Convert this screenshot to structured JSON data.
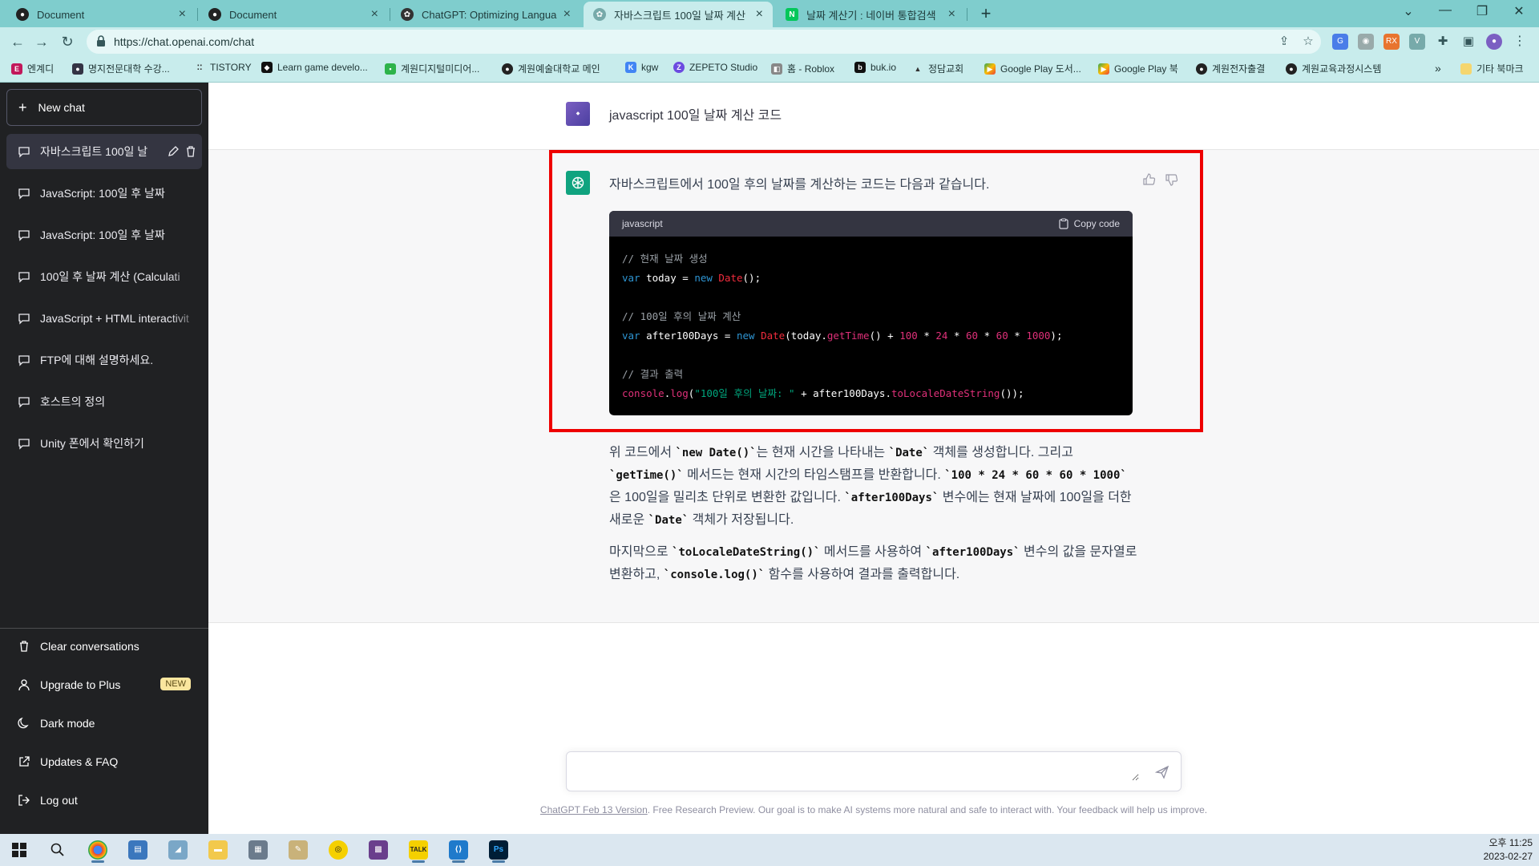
{
  "tabs": [
    {
      "title": "Document",
      "active": false,
      "favicon": "github-icon"
    },
    {
      "title": "Document",
      "active": false,
      "favicon": "github-icon"
    },
    {
      "title": "ChatGPT: Optimizing Language",
      "active": false,
      "favicon": "openai-icon"
    },
    {
      "title": "자바스크립트 100일 날짜 계산",
      "active": true,
      "favicon": "openai-icon"
    },
    {
      "title": "날짜 계산기 : 네이버 통합검색",
      "active": false,
      "favicon": "naver-icon"
    }
  ],
  "address_bar": {
    "url": "https://chat.openai.com/chat"
  },
  "bookmarks": [
    {
      "label": "엔계디",
      "icon": "bookmark-icon"
    },
    {
      "label": "명지전문대학 수강...",
      "icon": "bookmark-icon"
    },
    {
      "label": "TISTORY",
      "icon": "bookmark-icon"
    },
    {
      "label": "Learn game develo...",
      "icon": "bookmark-icon"
    },
    {
      "label": "계원디지털미디어...",
      "icon": "bookmark-icon"
    },
    {
      "label": "계원예술대학교 메인",
      "icon": "bookmark-icon"
    },
    {
      "label": "kgw",
      "icon": "bookmark-icon"
    },
    {
      "label": "ZEPETO Studio",
      "icon": "bookmark-icon"
    },
    {
      "label": "홈 - Roblox",
      "icon": "bookmark-icon"
    },
    {
      "label": "buk.io",
      "icon": "bookmark-icon"
    },
    {
      "label": "정담교회",
      "icon": "bookmark-icon"
    },
    {
      "label": "Google Play 도서...",
      "icon": "google-play-icon"
    },
    {
      "label": "Google Play 북",
      "icon": "google-play-icon"
    },
    {
      "label": "계원전자출결",
      "icon": "bookmark-icon"
    },
    {
      "label": "계원교육과정시스템",
      "icon": "bookmark-icon"
    }
  ],
  "bookmarks_overflow": "»",
  "bookmarks_other": "기타 북마크",
  "sidebar": {
    "new_chat": "New chat",
    "conversations": [
      {
        "label": "자바스크립트 100일 날",
        "active": true
      },
      {
        "label": "JavaScript: 100일 후 날짜",
        "active": false
      },
      {
        "label": "JavaScript: 100일 후 날짜",
        "active": false
      },
      {
        "label": "100일 후 날짜 계산 (Calculati",
        "active": false
      },
      {
        "label": "JavaScript + HTML interactivit",
        "active": false
      },
      {
        "label": "FTP에 대해 설명하세요.",
        "active": false
      },
      {
        "label": "호스트의 정의",
        "active": false
      },
      {
        "label": "Unity 폰에서 확인하기",
        "active": false
      }
    ],
    "bottom": {
      "clear": "Clear conversations",
      "upgrade": "Upgrade to Plus",
      "upgrade_badge": "NEW",
      "dark_mode": "Dark mode",
      "updates": "Updates & FAQ",
      "logout": "Log out"
    }
  },
  "chat": {
    "user_message": "javascript 100일 날짜 계산 코드",
    "assistant_intro": "자바스크립트에서 100일 후의 날짜를 계산하는 코드는 다음과 같습니다.",
    "code_block": {
      "language": "javascript",
      "copy_label": "Copy code",
      "lines": [
        "// 현재 날짜 생성",
        "var today = new Date();",
        "",
        "// 100일 후의 날짜 계산",
        "var after100Days = new Date(today.getTime() + 100 * 24 * 60 * 60 * 1000);",
        "",
        "// 결과 출력",
        "console.log(\"100일 후의 날짜: \" + after100Days.toLocaleDateString());"
      ]
    },
    "paragraph1": {
      "t1": "위 코드에서 ",
      "c1": "`new Date()`",
      "t2": "는 현재 시간을 나타내는 ",
      "c2": "`Date`",
      "t3": " 객체를 생성합니다. 그리고 ",
      "c3": "`getTime()`",
      "t4": " 메서드는 현재 시간의 타임스탬프를 반환합니다. ",
      "c4": "`100 * 24 * 60 * 60 * 1000`",
      "t5": "은 100일을 밀리초 단위로 변환한 값입니다. ",
      "c5": "`after100Days`",
      "t6": " 변수에는 현재 날짜에 100일을 더한 새로운 ",
      "c6": "`Date`",
      "t7": " 객체가 저장됩니다."
    },
    "paragraph2": {
      "t1": "마지막으로 ",
      "c1": "`toLocaleDateString()`",
      "t2": " 메서드를 사용하여 ",
      "c2": "`after100Days`",
      "t3": " 변수의 값을 문자열로 변환하고, ",
      "c3": "`console.log()`",
      "t4": " 함수를 사용하여 결과를 출력합니다."
    },
    "composer_value": "",
    "footer_link": "ChatGPT Feb 13 Version",
    "footer_text": ". Free Research Preview. Our goal is to make AI systems more natural and safe to interact with. Your feedback will help us improve."
  },
  "taskbar": {
    "apps": [
      "windows-start-icon",
      "search-icon",
      "chrome-icon",
      "app-icon",
      "app-icon",
      "file-explorer-icon",
      "calculator-icon",
      "app-icon",
      "kakaotalk-icon",
      "app-icon",
      "kakaotalk-icon",
      "vscode-icon",
      "photoshop-icon"
    ],
    "time": "오후 11:25",
    "date": "2023-02-27"
  },
  "colors": {
    "chrome_frame": "#7fcdcd",
    "sidebar_bg": "#202123",
    "assistant_bg": "#f7f7f8",
    "openai_green": "#10a37f",
    "highlight_red": "#e00000"
  }
}
